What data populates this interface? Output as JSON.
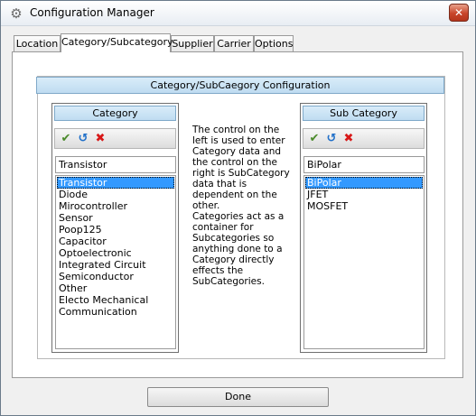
{
  "window": {
    "title": "Configuration Manager",
    "icon": "gear-icon",
    "close_label": "✕"
  },
  "tabs": [
    {
      "label": "Location",
      "active": false
    },
    {
      "label": "Category/Subcategory",
      "active": true
    },
    {
      "label": "Supplier",
      "active": false
    },
    {
      "label": "Carrier",
      "active": false
    },
    {
      "label": "Options",
      "active": false
    }
  ],
  "config": {
    "header": "Category/SubCaegory Configuration"
  },
  "category": {
    "header": "Category",
    "toolbar": {
      "ok_icon": "checkmark-icon",
      "undo_icon": "undo-icon",
      "delete_icon": "delete-icon"
    },
    "input_value": "Transistor",
    "items": [
      "Transistor",
      "Diode",
      "Mirocontroller",
      "Sensor",
      "Poop125",
      "Capacitor",
      "Optoelectronic",
      "Integrated Circuit",
      "Semiconductor",
      "Other",
      "Electo Mechanical",
      "Communication"
    ],
    "selected_index": 0
  },
  "subcategory": {
    "header": "Sub Category",
    "toolbar": {
      "ok_icon": "checkmark-icon",
      "undo_icon": "undo-icon",
      "delete_icon": "delete-icon"
    },
    "input_value": "BiPolar",
    "items": [
      "BiPolar",
      "JFET",
      "MOSFET"
    ],
    "selected_index": 0
  },
  "help_text": "The control on the left is used to enter Category data and the control on the right is SubCategory data that is dependent on the other.\nCategories act as a container for Subcategories so anything done to a Category directly effects the SubCategories.",
  "footer": {
    "done_label": "Done"
  },
  "colors": {
    "header_blue": "#bfdcf1",
    "selection": "#3399ff",
    "close_red": "#c8452a"
  }
}
